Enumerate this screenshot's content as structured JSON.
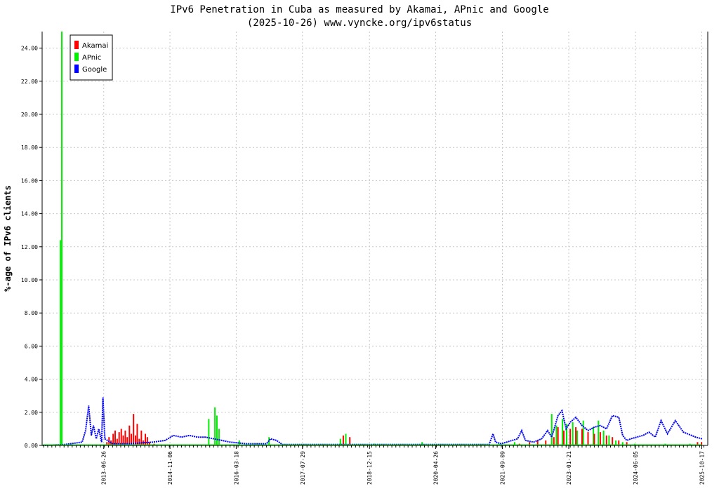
{
  "chart_data": {
    "type": "line",
    "title": "IPv6 Penetration in Cuba as measured by Akamai, APnic and Google",
    "subtitle": "(2025-10-26) www.vyncke.org/ipv6status",
    "xlabel": "",
    "ylabel": "%-age of IPv6 clients",
    "xlim": [
      "2012-03-20",
      "2025-12-01"
    ],
    "ylim": [
      0,
      25
    ],
    "grid": true,
    "legend_position": "top-left",
    "x_ticks": [
      "2013-06-26",
      "2014-11-06",
      "2016-03-18",
      "2017-07-29",
      "2018-12-15",
      "2020-04-26",
      "2021-09-09",
      "2023-01-21",
      "2024-06-05",
      "2025-10-17"
    ],
    "y_ticks": [
      "0.00",
      "2.00",
      "4.00",
      "6.00",
      "8.00",
      "10.00",
      "12.00",
      "14.00",
      "16.00",
      "18.00",
      "20.00",
      "22.00",
      "24.00"
    ],
    "series": [
      {
        "name": "Akamai",
        "color": "#ff0000",
        "style": "bars",
        "points": [
          [
            "2013-07-20",
            0.2
          ],
          [
            "2013-08-05",
            0.5
          ],
          [
            "2013-08-20",
            0.3
          ],
          [
            "2013-09-05",
            0.7
          ],
          [
            "2013-09-20",
            0.9
          ],
          [
            "2013-10-05",
            0.4
          ],
          [
            "2013-10-20",
            0.8
          ],
          [
            "2013-11-05",
            1.0
          ],
          [
            "2013-11-20",
            0.6
          ],
          [
            "2013-12-05",
            0.9
          ],
          [
            "2013-12-20",
            0.5
          ],
          [
            "2014-01-05",
            1.2
          ],
          [
            "2014-01-20",
            0.7
          ],
          [
            "2014-02-05",
            1.9
          ],
          [
            "2014-02-20",
            0.6
          ],
          [
            "2014-03-05",
            1.3
          ],
          [
            "2014-03-20",
            0.4
          ],
          [
            "2014-04-05",
            0.9
          ],
          [
            "2014-04-20",
            0.3
          ],
          [
            "2014-05-05",
            0.7
          ],
          [
            "2014-05-20",
            0.5
          ],
          [
            "2014-06-05",
            0.2
          ],
          [
            "2014-07-10",
            0.1
          ],
          [
            "2018-06-01",
            0.6
          ],
          [
            "2018-07-20",
            0.5
          ],
          [
            "2022-01-15",
            0.1
          ],
          [
            "2022-04-01",
            0.2
          ],
          [
            "2022-06-01",
            0.3
          ],
          [
            "2022-08-01",
            0.3
          ],
          [
            "2022-10-01",
            0.5
          ],
          [
            "2022-11-01",
            1.1
          ],
          [
            "2022-12-15",
            0.9
          ],
          [
            "2023-02-01",
            1.0
          ],
          [
            "2023-03-15",
            1.1
          ],
          [
            "2023-05-01",
            1.0
          ],
          [
            "2023-06-15",
            0.8
          ],
          [
            "2023-08-01",
            0.7
          ],
          [
            "2023-09-15",
            0.8
          ],
          [
            "2023-11-01",
            0.6
          ],
          [
            "2023-12-15",
            0.5
          ],
          [
            "2024-02-01",
            0.3
          ],
          [
            "2024-04-01",
            0.2
          ],
          [
            "2025-09-15",
            0.2
          ],
          [
            "2025-10-15",
            0.2
          ]
        ]
      },
      {
        "name": "APnic",
        "color": "#00ee00",
        "style": "bars",
        "points": [
          [
            "2012-08-05",
            12.4
          ],
          [
            "2012-08-15",
            25.0
          ],
          [
            "2015-08-25",
            1.6
          ],
          [
            "2015-10-10",
            2.3
          ],
          [
            "2015-10-25",
            1.8
          ],
          [
            "2015-11-10",
            1.0
          ],
          [
            "2016-04-10",
            0.3
          ],
          [
            "2016-11-20",
            0.5
          ],
          [
            "2018-05-10",
            0.4
          ],
          [
            "2018-06-20",
            0.7
          ],
          [
            "2019-01-20",
            0.1
          ],
          [
            "2020-01-15",
            0.2
          ],
          [
            "2021-08-15",
            0.1
          ],
          [
            "2021-12-10",
            0.2
          ],
          [
            "2022-09-15",
            1.9
          ],
          [
            "2022-10-20",
            1.2
          ],
          [
            "2022-12-05",
            1.6
          ],
          [
            "2023-01-05",
            1.3
          ],
          [
            "2023-02-20",
            1.4
          ],
          [
            "2023-03-25",
            0.9
          ],
          [
            "2023-05-10",
            1.5
          ],
          [
            "2023-06-15",
            0.8
          ],
          [
            "2023-07-25",
            1.1
          ],
          [
            "2023-09-01",
            1.5
          ],
          [
            "2023-10-10",
            0.9
          ],
          [
            "2023-11-20",
            0.6
          ],
          [
            "2024-01-10",
            0.3
          ],
          [
            "2024-03-01",
            0.2
          ],
          [
            "2024-06-01",
            0.1
          ],
          [
            "2025-01-15",
            0.1
          ],
          [
            "2025-07-20",
            0.1
          ]
        ]
      },
      {
        "name": "Google",
        "color": "#0000ff",
        "style": "dotted-line",
        "points": [
          [
            "2012-03-25",
            0.0
          ],
          [
            "2012-09-01",
            0.05
          ],
          [
            "2012-12-01",
            0.15
          ],
          [
            "2013-01-15",
            0.2
          ],
          [
            "2013-02-10",
            0.9
          ],
          [
            "2013-03-05",
            2.4
          ],
          [
            "2013-03-25",
            0.6
          ],
          [
            "2013-04-10",
            1.2
          ],
          [
            "2013-05-01",
            0.4
          ],
          [
            "2013-05-20",
            1.0
          ],
          [
            "2013-06-10",
            0.2
          ],
          [
            "2013-06-20",
            2.9
          ],
          [
            "2013-07-05",
            0.4
          ],
          [
            "2013-09-01",
            0.1
          ],
          [
            "2014-01-01",
            0.1
          ],
          [
            "2014-07-01",
            0.2
          ],
          [
            "2014-10-01",
            0.3
          ],
          [
            "2014-12-01",
            0.6
          ],
          [
            "2015-02-01",
            0.5
          ],
          [
            "2015-04-01",
            0.6
          ],
          [
            "2015-06-01",
            0.5
          ],
          [
            "2015-08-01",
            0.5
          ],
          [
            "2015-10-01",
            0.4
          ],
          [
            "2015-12-01",
            0.3
          ],
          [
            "2016-02-01",
            0.2
          ],
          [
            "2016-06-01",
            0.1
          ],
          [
            "2016-11-01",
            0.1
          ],
          [
            "2016-12-01",
            0.4
          ],
          [
            "2017-01-15",
            0.3
          ],
          [
            "2017-03-01",
            0.05
          ],
          [
            "2018-01-01",
            0.05
          ],
          [
            "2019-01-01",
            0.05
          ],
          [
            "2020-01-01",
            0.05
          ],
          [
            "2021-01-01",
            0.05
          ],
          [
            "2021-06-01",
            0.05
          ],
          [
            "2021-07-01",
            0.7
          ],
          [
            "2021-07-20",
            0.2
          ],
          [
            "2021-09-01",
            0.1
          ],
          [
            "2022-01-01",
            0.4
          ],
          [
            "2022-02-01",
            0.9
          ],
          [
            "2022-03-01",
            0.3
          ],
          [
            "2022-05-01",
            0.2
          ],
          [
            "2022-07-01",
            0.4
          ],
          [
            "2022-08-15",
            0.9
          ],
          [
            "2022-09-15",
            0.5
          ],
          [
            "2022-11-01",
            1.8
          ],
          [
            "2022-12-01",
            2.1
          ],
          [
            "2023-01-01",
            1.0
          ],
          [
            "2023-02-01",
            1.4
          ],
          [
            "2023-03-15",
            1.7
          ],
          [
            "2023-05-01",
            1.2
          ],
          [
            "2023-06-15",
            0.9
          ],
          [
            "2023-08-01",
            1.1
          ],
          [
            "2023-09-15",
            1.2
          ],
          [
            "2023-11-01",
            1.0
          ],
          [
            "2023-12-15",
            1.8
          ],
          [
            "2024-02-01",
            1.7
          ],
          [
            "2024-03-01",
            0.6
          ],
          [
            "2024-04-01",
            0.3
          ],
          [
            "2024-05-01",
            0.4
          ],
          [
            "2024-06-15",
            0.5
          ],
          [
            "2024-08-01",
            0.6
          ],
          [
            "2024-09-15",
            0.8
          ],
          [
            "2024-11-01",
            0.5
          ],
          [
            "2024-12-15",
            1.5
          ],
          [
            "2025-02-01",
            0.7
          ],
          [
            "2025-04-01",
            1.5
          ],
          [
            "2025-06-01",
            0.8
          ],
          [
            "2025-08-01",
            0.6
          ],
          [
            "2025-09-01",
            0.5
          ],
          [
            "2025-10-20",
            0.4
          ]
        ]
      }
    ]
  }
}
